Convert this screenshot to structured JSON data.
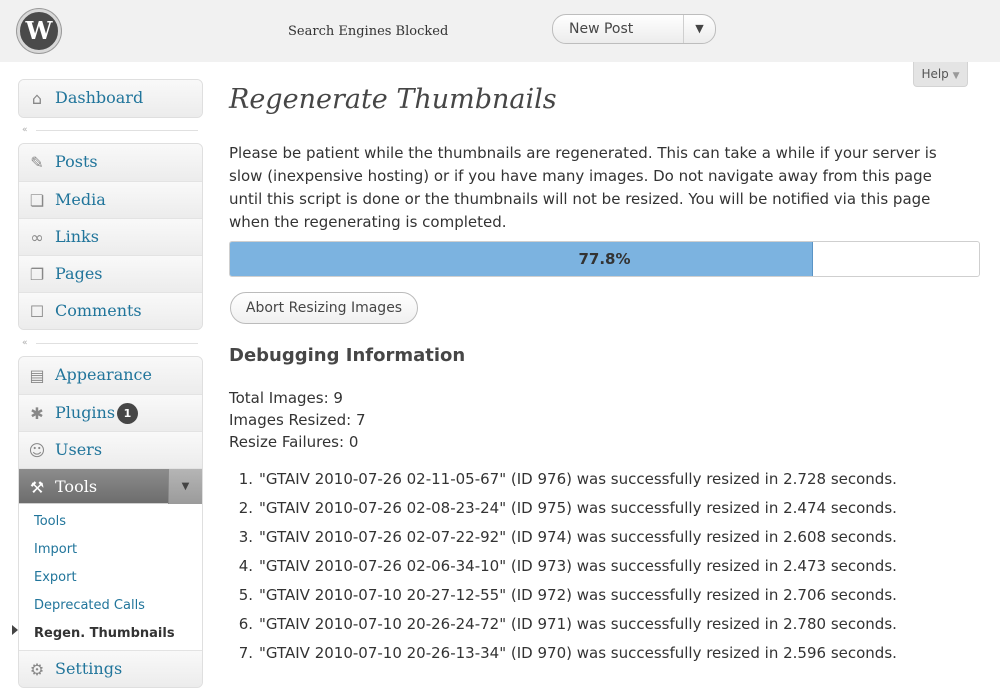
{
  "header": {
    "logo_glyph": "W",
    "site_status": "Search Engines Blocked",
    "favorite_action": "New Post",
    "favorite_toggle_glyph": "▼"
  },
  "help": {
    "label": "Help",
    "arrow": "▼"
  },
  "sidebar": {
    "dashboard": {
      "label": "Dashboard",
      "icon": "dashboard-icon",
      "glyph": "⌂"
    },
    "collapse_glyph": "«",
    "group1": [
      {
        "label": "Posts",
        "icon": "pin-icon",
        "glyph": "✎"
      },
      {
        "label": "Media",
        "icon": "media-icon",
        "glyph": "❏"
      },
      {
        "label": "Links",
        "icon": "link-icon",
        "glyph": "∞"
      },
      {
        "label": "Pages",
        "icon": "pages-icon",
        "glyph": "❐"
      },
      {
        "label": "Comments",
        "icon": "comment-icon",
        "glyph": "☐"
      }
    ],
    "group2": [
      {
        "label": "Appearance",
        "icon": "appearance-icon",
        "glyph": "▤"
      },
      {
        "label": "Plugins",
        "icon": "plugin-icon",
        "glyph": "✱",
        "badge": "1"
      },
      {
        "label": "Users",
        "icon": "users-icon",
        "glyph": "☺"
      }
    ],
    "tools": {
      "label": "Tools",
      "icon": "tools-icon",
      "glyph": "⚒",
      "toggle_glyph": "▼",
      "submenu": [
        "Tools",
        "Import",
        "Export",
        "Deprecated Calls",
        "Regen. Thumbnails"
      ]
    },
    "settings": {
      "label": "Settings",
      "icon": "settings-icon",
      "glyph": "⚙"
    }
  },
  "content": {
    "title": "Regenerate Thumbnails",
    "intro": "Please be patient while the thumbnails are regenerated. This can take a while if your server is slow (inexpensive hosting) or if you have many images. Do not navigate away from this page until this script is done or the thumbnails will not be resized. You will be notified via this page when the regenerating is completed.",
    "progress": {
      "percent": 77.8,
      "label": "77.8%"
    },
    "abort_label": "Abort Resizing Images",
    "debug_title": "Debugging Information",
    "stats": {
      "total": "Total Images: 9",
      "resized": "Images Resized: 7",
      "failures": "Resize Failures: 0"
    },
    "results": [
      {
        "num": "1.",
        "text": "\"GTAIV 2010-07-26 02-11-05-67\" (ID 976) was successfully resized in 2.728 seconds."
      },
      {
        "num": "2.",
        "text": "\"GTAIV 2010-07-26 02-08-23-24\" (ID 975) was successfully resized in 2.474 seconds."
      },
      {
        "num": "3.",
        "text": "\"GTAIV 2010-07-26 02-07-22-92\" (ID 974) was successfully resized in 2.608 seconds."
      },
      {
        "num": "4.",
        "text": "\"GTAIV 2010-07-26 02-06-34-10\" (ID 973) was successfully resized in 2.473 seconds."
      },
      {
        "num": "5.",
        "text": "\"GTAIV 2010-07-10 20-27-12-55\" (ID 972) was successfully resized in 2.706 seconds."
      },
      {
        "num": "6.",
        "text": "\"GTAIV 2010-07-10 20-26-24-72\" (ID 971) was successfully resized in 2.780 seconds."
      },
      {
        "num": "7.",
        "text": "\"GTAIV 2010-07-10 20-26-13-34\" (ID 970) was successfully resized in 2.596 seconds."
      }
    ]
  },
  "colors": {
    "link": "#21759b",
    "progress_fill": "#7cb3e0",
    "menu_current": "#7a7a7a"
  }
}
